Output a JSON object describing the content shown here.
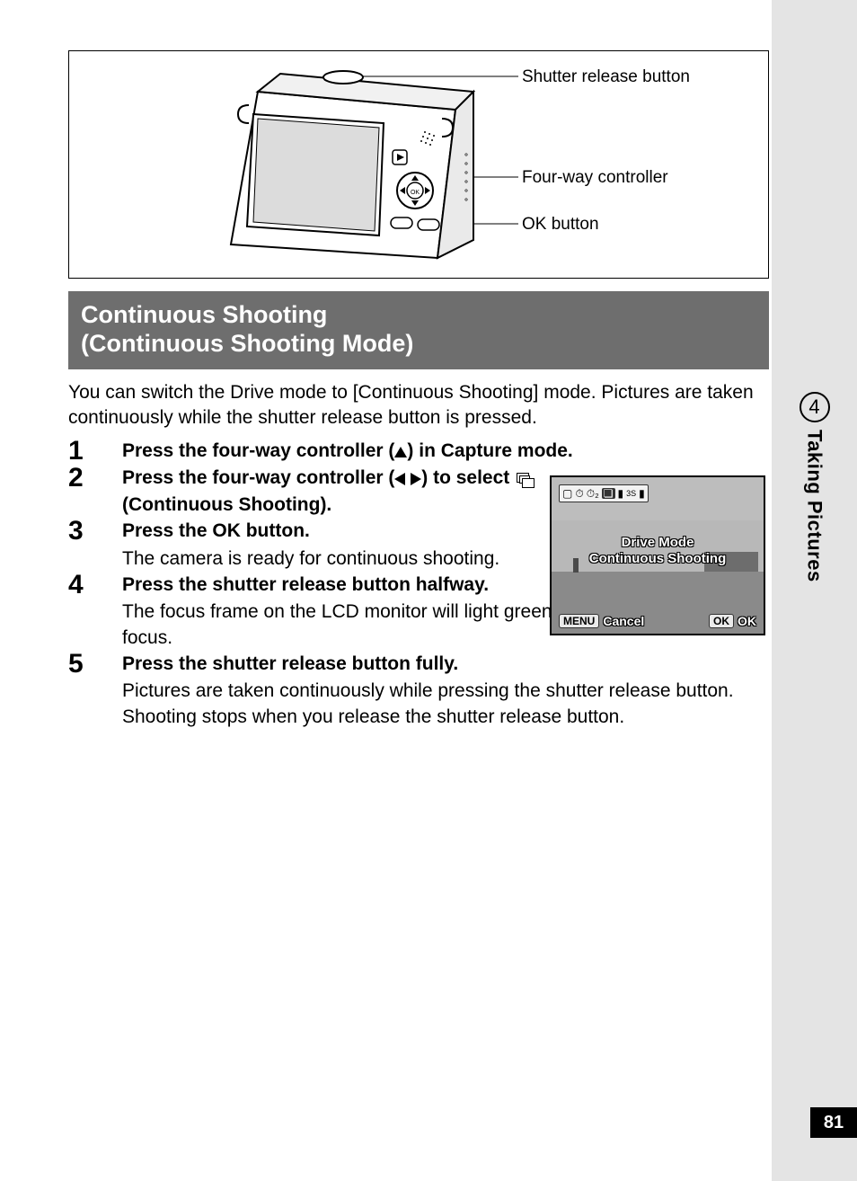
{
  "chapter": {
    "number": "4",
    "title": "Taking Pictures"
  },
  "page_number": "81",
  "diagram": {
    "callouts": {
      "shutter": "Shutter release button",
      "fourway": "Four-way controller",
      "ok": "OK button"
    }
  },
  "section": {
    "title_line1": "Continuous Shooting",
    "title_line2": "(Continuous Shooting Mode)"
  },
  "intro": "You can switch the Drive mode to [Continuous Shooting] mode. Pictures are taken continuously while the shutter release button is pressed.",
  "steps": {
    "s1": {
      "num": "1",
      "title_a": "Press the four-way controller (",
      "title_b": ") in Capture mode."
    },
    "s2": {
      "num": "2",
      "title_a": "Press the four-way controller (",
      "title_b": ") to select ",
      "title_c": " (Continuous Shooting)."
    },
    "s3": {
      "num": "3",
      "title": "Press the OK button.",
      "desc": "The camera is ready for continuous shooting."
    },
    "s4": {
      "num": "4",
      "title": "Press the shutter release button halfway.",
      "desc": "The focus frame on the LCD monitor will light green when the camera is in focus."
    },
    "s5": {
      "num": "5",
      "title": "Press the shutter release button fully.",
      "desc": "Pictures are taken continuously while pressing the shutter release button. Shooting stops when you release the shutter release button."
    }
  },
  "lcd": {
    "mode_label_1": "Drive Mode",
    "mode_label_2": "Continuous Shooting",
    "menu_chip": "MENU",
    "menu_label": "Cancel",
    "ok_chip": "OK",
    "ok_label": "OK",
    "modebar_suffix": "3S"
  }
}
